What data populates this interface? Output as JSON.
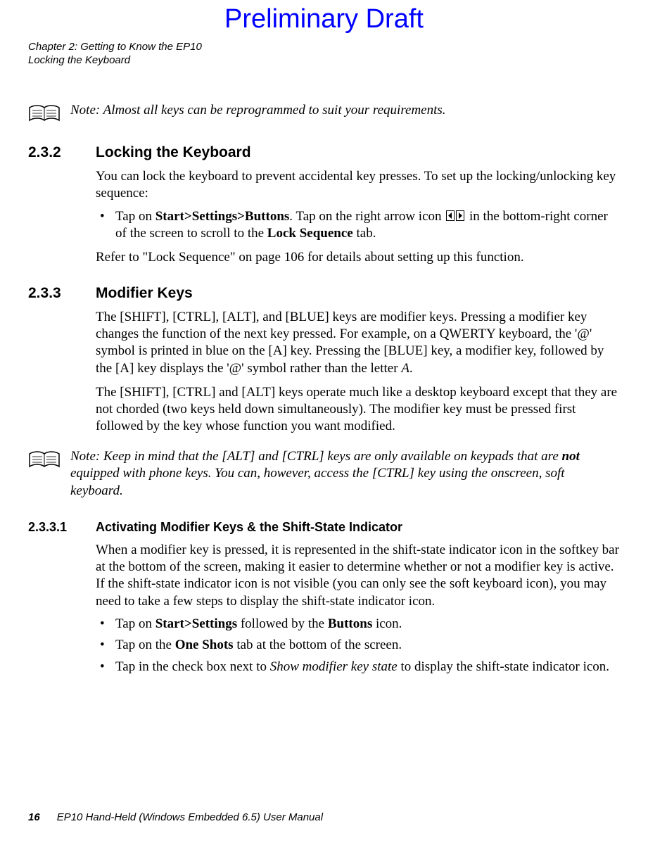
{
  "watermark": "Preliminary Draft",
  "running_head": {
    "line1": "Chapter 2: Getting to Know the EP10",
    "line2": "Locking the Keyboard"
  },
  "note1": {
    "label": "Note:",
    "text": "Almost all keys can be reprogrammed to suit your requirements."
  },
  "s232": {
    "num": "2.3.2",
    "title": "Locking the Keyboard",
    "p1": "You can lock the keyboard to prevent accidental key presses. To set up the locking/unlocking key sequence:",
    "bullet1_a": "Tap on ",
    "bullet1_b_bold": "Start>Settings>Buttons",
    "bullet1_c": ". Tap on the right arrow icon ",
    "bullet1_d": " in the bottom-right corner of the screen to scroll to the ",
    "bullet1_e_bold": "Lock Sequence",
    "bullet1_f": " tab.",
    "p2": "Refer to \"Lock Sequence\" on page 106 for details about setting up this function."
  },
  "s233": {
    "num": "2.3.3",
    "title": "Modifier Keys",
    "p1_a": "The [SHIFT], [CTRL], [ALT], and [BLUE] keys are modifier keys. Pressing a modifier key changes the function of the next key pressed. For example, on a QWERTY keyboard, the '@' symbol is printed in blue on the [A] key. Pressing the [BLUE] key, a modifier key, followed by the [A] key displays the '@' symbol rather than the letter ",
    "p1_b_ital": "A",
    "p1_c": ".",
    "p2": "The [SHIFT], [CTRL] and [ALT] keys operate much like a desktop keyboard except that they are not chorded (two keys held down simultaneously). The modifier key must be pressed first followed by the key whose function you want modified."
  },
  "note2": {
    "label": "Note:",
    "text_a": "Keep in mind that the [ALT] and [CTRL] keys are only available on keypads that are ",
    "text_b_bold": "not",
    "text_c": " equipped with phone keys. You can, however, access the [CTRL] key using the onscreen, soft keyboard."
  },
  "s2331": {
    "num": "2.3.3.1",
    "title": "Activating Modifier Keys & the Shift-State Indicator",
    "p1": "When a modifier key is pressed, it is represented in the shift-state indicator icon in the softkey bar at the bottom of the screen, making it easier to determine whether or not a modifier key is active. If the shift-state indicator icon is not visible (you can only see the soft keyboard icon), you may need to take a few steps to display the shift-state indicator icon.",
    "b1_a": "Tap on ",
    "b1_b_bold": "Start>Settings",
    "b1_c": " followed by the ",
    "b1_d_bold": "Buttons",
    "b1_e": " icon.",
    "b2_a": "Tap on the ",
    "b2_b_bold": "One Shots",
    "b2_c": " tab at the bottom of the screen.",
    "b3_a": "Tap in the check box next to ",
    "b3_b_ital": "Show modifier key state",
    "b3_c": " to display the shift-state indicator icon."
  },
  "footer": {
    "page": "16",
    "title": "EP10 Hand-Held (Windows Embedded 6.5) User Manual"
  }
}
